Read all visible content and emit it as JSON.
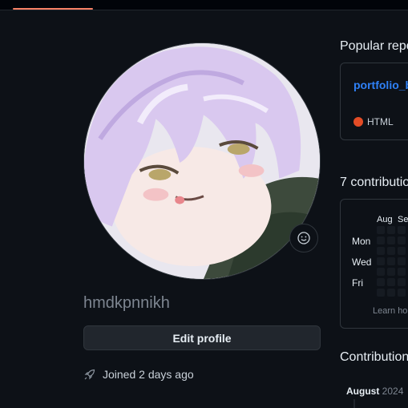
{
  "profile": {
    "username": "hmdkpnnikh",
    "edit_label": "Edit profile",
    "joined": "Joined 2 days ago"
  },
  "popular": {
    "title": "Popular repo",
    "repo_name": "portfolio_b",
    "language": "HTML",
    "language_color": "#e34c26"
  },
  "contributions": {
    "title": "7 contributio",
    "months": [
      "Aug",
      "Se"
    ],
    "days": [
      "Mon",
      "Wed",
      "Fri"
    ],
    "learn": "Learn ho"
  },
  "activity": {
    "title": "Contribution",
    "month": "August",
    "year": "2024"
  },
  "colors": {
    "accent": "#f78166",
    "link": "#2f81f7",
    "background": "#0d1117"
  },
  "icons": {
    "status": "smiley-icon",
    "joined": "rocket-icon"
  }
}
